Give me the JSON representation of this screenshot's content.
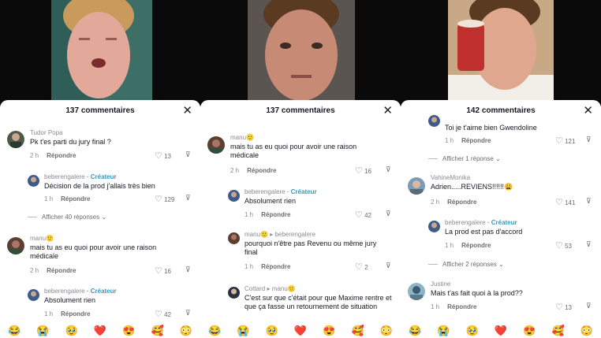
{
  "emoji_bar": [
    "😂",
    "😭",
    "🥹",
    "❤️",
    "😍",
    "🥰",
    "😳"
  ],
  "panels": [
    {
      "count_label": "137 commentaires",
      "comments": [
        {
          "user": "Tudor Popa",
          "text": "Pk t'es parti du jury final ?",
          "time": "2 h",
          "reply": "Répondre",
          "likes": "13"
        },
        {
          "user": "beberengalere",
          "badge": "· Créateur",
          "text": "Décision de la prod j'allais très bien",
          "time": "1 h",
          "reply": "Répondre",
          "likes": "129"
        },
        {
          "more": "Afficher 40 réponses ⌄"
        },
        {
          "user": "manu🙂",
          "text": "mais tu as eu quoi pour avoir une raison médicale",
          "time": "2 h",
          "reply": "Répondre",
          "likes": "16"
        },
        {
          "user": "beberengalere",
          "badge": "· Créateur",
          "text": "Absolument rien",
          "time": "1 h",
          "reply": "Répondre",
          "likes": "42"
        }
      ]
    },
    {
      "count_label": "137 commentaires",
      "comments": [
        {
          "user": "manu🙂",
          "text": "mais tu as eu quoi pour avoir une raison médicale",
          "time": "2 h",
          "reply": "Répondre",
          "likes": "16"
        },
        {
          "user": "beberengalere",
          "badge": "· Créateur",
          "text": "Absolument rien",
          "time": "1 h",
          "reply": "Répondre",
          "likes": "42"
        },
        {
          "user": "manu🙂 ▸ beberengalere",
          "text": "pourquoi n'être pas Revenu ou même jury final",
          "time": "1 h",
          "reply": "Répondre",
          "likes": "2"
        },
        {
          "user": "Cottard ▸ manu🙂",
          "text": "C'est sur que c'était pour que Maxime rentre et que ça fasse un retournement de situation",
          "time": "",
          "reply": "",
          "likes": ""
        }
      ]
    },
    {
      "count_label": "142 commentaires",
      "comments": [
        {
          "user": "",
          "text": "Toi je t'aime bien Gwendoline",
          "time": "1 h",
          "reply": "Répondre",
          "likes": "121"
        },
        {
          "more": "Afficher 1 réponse ⌄"
        },
        {
          "user": "VahineMonika",
          "text": "Adrien.....REVIENS!!!!!!😩",
          "time": "2 h",
          "reply": "Répondre",
          "likes": "141"
        },
        {
          "user": "beberengalere",
          "badge": "· Créateur",
          "text": "La prod est pas d'accord",
          "time": "1 h",
          "reply": "Répondre",
          "likes": "53"
        },
        {
          "more": "Afficher 2 réponses ⌄"
        },
        {
          "user": "Justine",
          "text": "Mais t'as fait quoi à la prod??",
          "time": "1 h",
          "reply": "Répondre",
          "likes": "13"
        }
      ]
    }
  ],
  "colors": {
    "creator": "#2f9cc9",
    "text": "#161823",
    "muted": "#8a8b91"
  }
}
